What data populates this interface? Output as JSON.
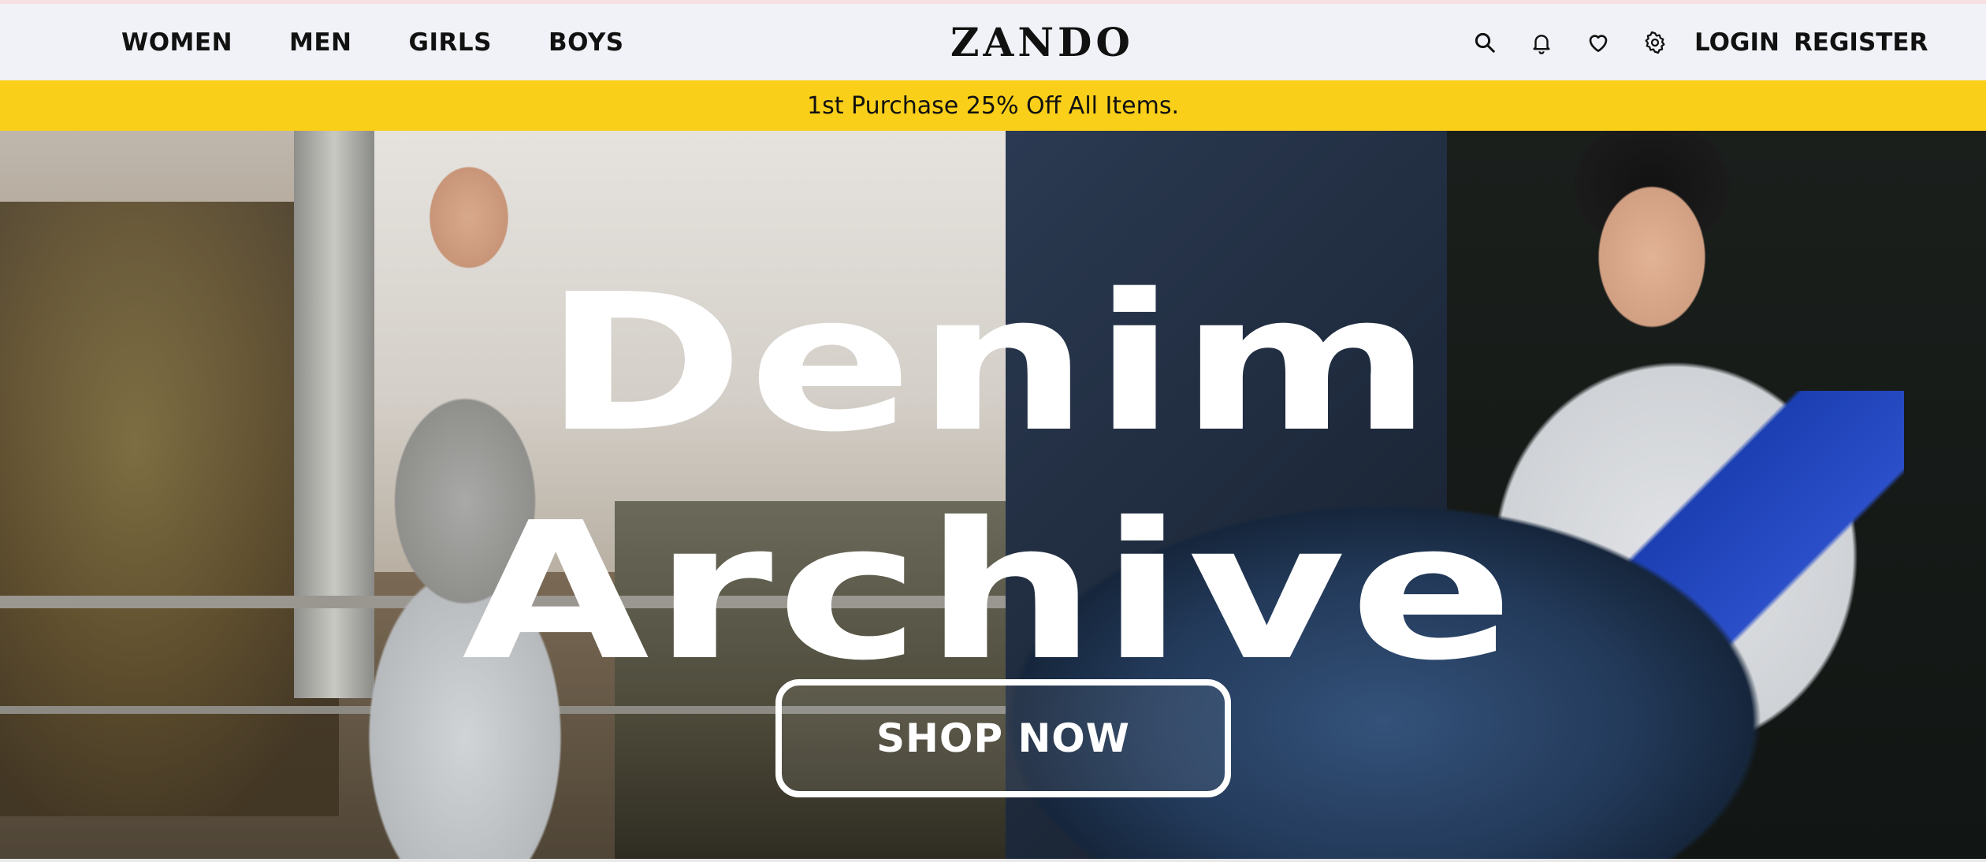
{
  "nav": {
    "categories": [
      "WOMEN",
      "MEN",
      "GIRLS",
      "BOYS"
    ],
    "logo": "ZANDO",
    "icons": [
      "search-icon",
      "bell-icon",
      "heart-icon",
      "gear-icon"
    ],
    "login_label": "LOGIN",
    "register_label": "REGISTER"
  },
  "promo": {
    "text": "1st Purchase 25% Off All Items."
  },
  "hero": {
    "title_line1": "Denim",
    "title_line2": "Archive",
    "cta_label": "SHOP NOW"
  },
  "colors": {
    "promo_bg": "#f9cf1a",
    "nav_bg": "#f0f2f7",
    "text": "#111111"
  }
}
